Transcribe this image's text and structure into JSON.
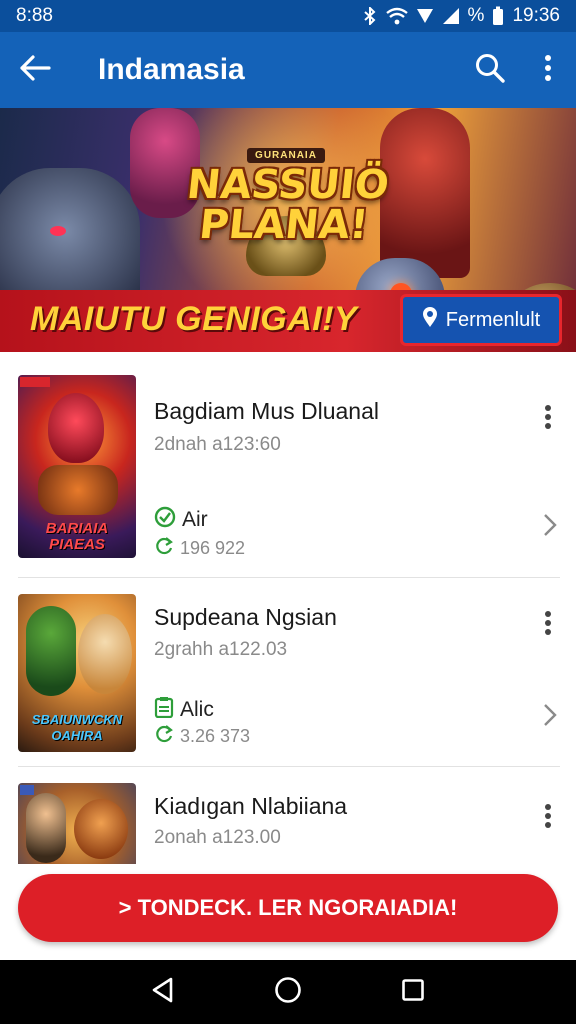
{
  "status_bar": {
    "time": "8:88",
    "battery_text": "%",
    "clock_right": "19:36"
  },
  "app_bar": {
    "title": "Indamasia",
    "icons": [
      "back-arrow-icon",
      "search-icon",
      "more-vert-icon"
    ]
  },
  "banner": {
    "logo_subtitle": "GURANAIA",
    "logo_title": "NASSUIÖ PLANA!",
    "tagline": "MAIUTU GENIGAI!Y",
    "button_label": "Fermenlult",
    "button_icon": "location-pin-icon"
  },
  "list": {
    "items": [
      {
        "title": "Bagdiam Mus Dluanal",
        "subtitle": "2dnah a123:60",
        "tag": "Air",
        "tag_icon": "check-circle-icon",
        "tag_color": "#2e9e3a",
        "count": "196 922",
        "count_icon": "refresh-icon",
        "thumb_text": "BARIAIA PIAEAS",
        "has_thumb_badge": true
      },
      {
        "title": "Supdeana Ngsian",
        "subtitle": "2grahh a122.03",
        "tag": "Alic",
        "tag_icon": "clipboard-icon",
        "tag_color": "#2e9e3a",
        "count": "3.26 373",
        "count_icon": "refresh-icon",
        "thumb_text": "SBAIUNWCKN OAHIRA",
        "has_thumb_badge": false
      },
      {
        "title": "Kiadıgan Nlabiiana",
        "subtitle": "2onah a123.00",
        "thumb_text": "",
        "has_thumb_badge": true
      }
    ]
  },
  "cta": {
    "label": "> TONDECK. LER NGORAIADIA!"
  },
  "nav_bar": {
    "icons": [
      "back-triangle-icon",
      "home-circle-icon",
      "recents-square-icon"
    ]
  },
  "colors": {
    "primary": "#1462b8",
    "status_bar": "#0b4f9c",
    "accent_red": "#dd1f27",
    "tagline_yellow": "#ffd23a"
  }
}
